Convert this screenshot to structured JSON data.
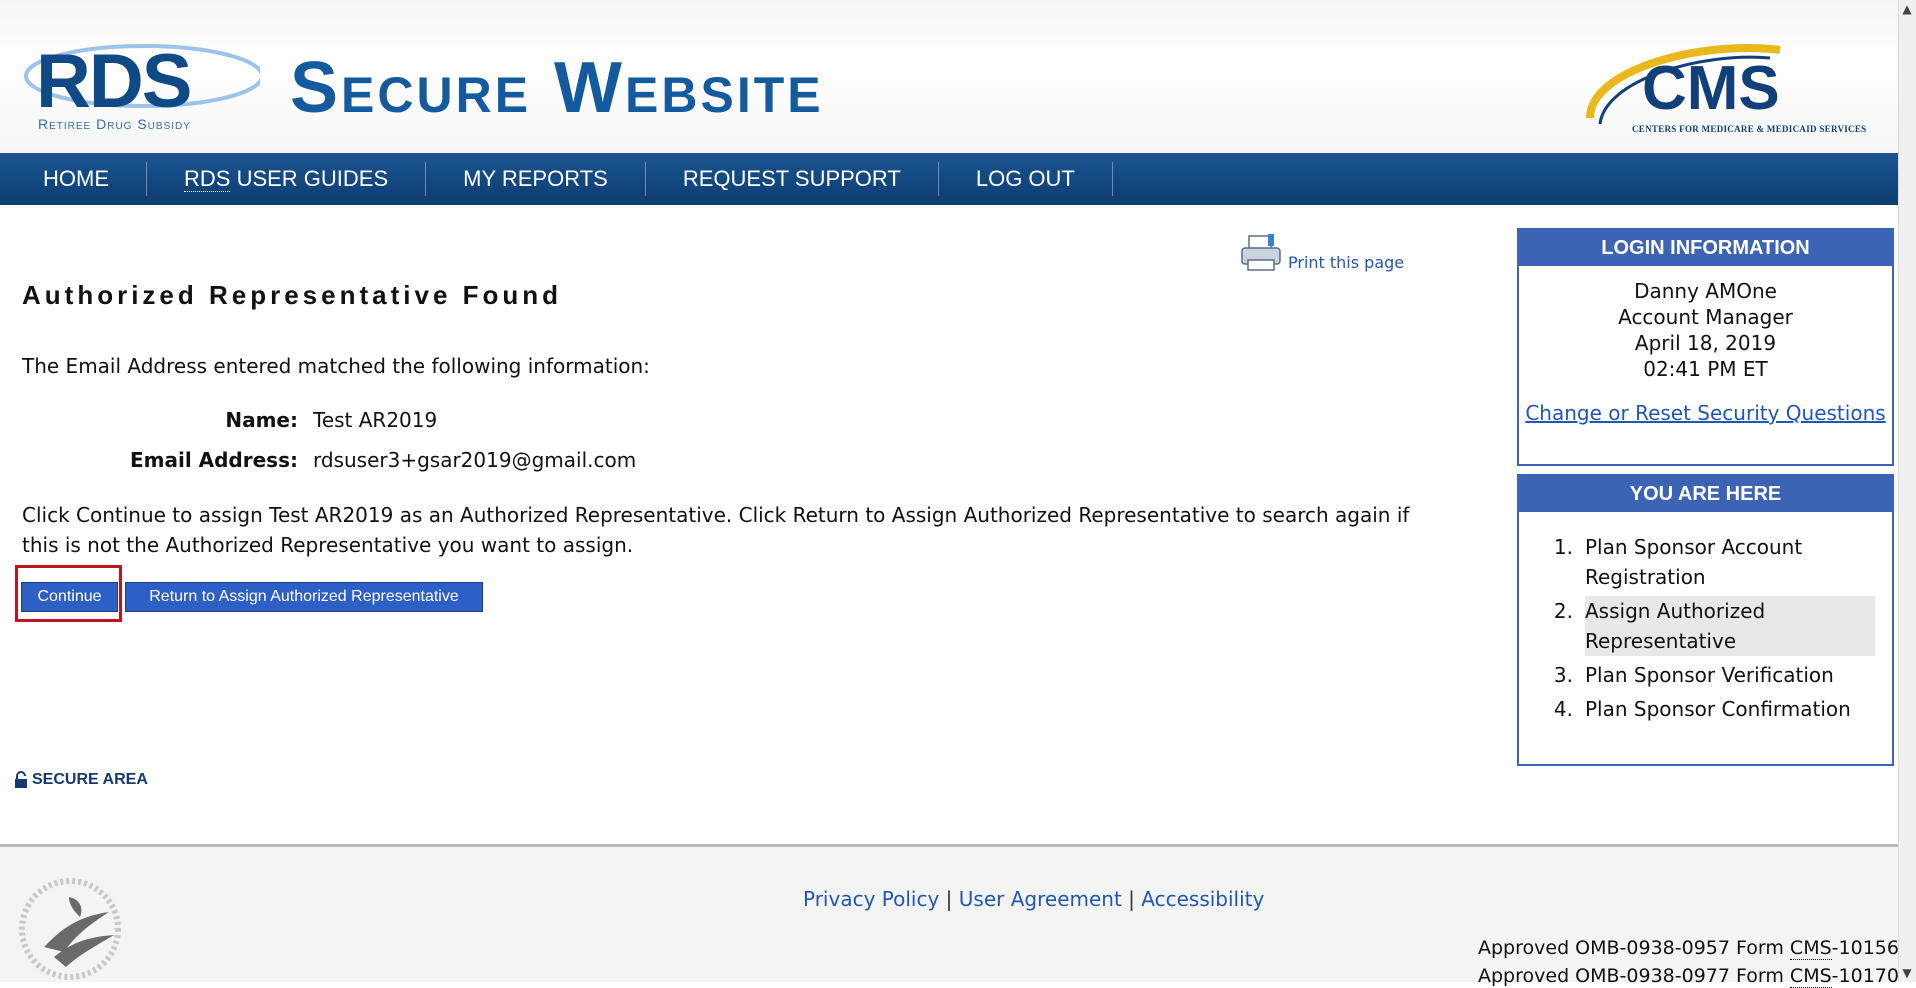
{
  "header": {
    "logo_text": "RDS",
    "logo_subtitle": "Retiree Drug Subsidy",
    "site_title": "Secure Website",
    "cms_logo_text": "CMS",
    "cms_logo_subtitle": "CENTERS FOR MEDICARE & MEDICAID SERVICES"
  },
  "nav": {
    "items": [
      {
        "label": "HOME"
      },
      {
        "label": "RDS USER GUIDES",
        "abbr": "RDS",
        "rest": " USER GUIDES"
      },
      {
        "label": "MY REPORTS"
      },
      {
        "label": "REQUEST SUPPORT"
      },
      {
        "label": "LOG OUT"
      }
    ]
  },
  "main": {
    "print_label": "Print this page",
    "heading": "Authorized Representative Found",
    "intro": "The Email Address entered matched the following information:",
    "fields": [
      {
        "label": "Name:",
        "value": "Test AR2019"
      },
      {
        "label": "Email Address:",
        "value": "rdsuser3+gsar2019@gmail.com"
      }
    ],
    "instructions": "Click Continue to assign Test AR2019 as an Authorized Representative. Click Return to Assign Authorized Representative to search again if this is not the Authorized Representative you want to assign.",
    "continue_label": "Continue",
    "return_label": "Return to Assign Authorized Representative",
    "secure_label": "SECURE AREA"
  },
  "login_info": {
    "title": "LOGIN INFORMATION",
    "user_name": "Danny AMOne",
    "role": "Account Manager",
    "date": "April 18, 2019",
    "time": "02:41 PM ET",
    "security_link": "Change or Reset Security Questions"
  },
  "you_are_here": {
    "title": "YOU ARE HERE",
    "steps": [
      {
        "num": "1.",
        "label": "Plan Sponsor Account Registration"
      },
      {
        "num": "2.",
        "label": "Assign Authorized Representative",
        "current": true
      },
      {
        "num": "3.",
        "label": "Plan Sponsor Verification"
      },
      {
        "num": "4.",
        "label": "Plan Sponsor Confirmation"
      }
    ]
  },
  "footer": {
    "privacy": "Privacy Policy",
    "sep": "|",
    "agreement": "User Agreement",
    "accessibility": "Accessibility",
    "omb_lines": [
      {
        "pre": "Approved OMB-0938-0957 Form ",
        "abbr": "CMS",
        "post": "-10156"
      },
      {
        "pre": "Approved OMB-0938-0977 Form ",
        "abbr": "CMS",
        "post": "-10170"
      }
    ]
  },
  "colors": {
    "nav_bg": "#0d3c71",
    "panel_header": "#3d63b4",
    "button_bg": "#2d5fc6",
    "link": "#1f57b5",
    "highlight_border": "#c2121e"
  }
}
